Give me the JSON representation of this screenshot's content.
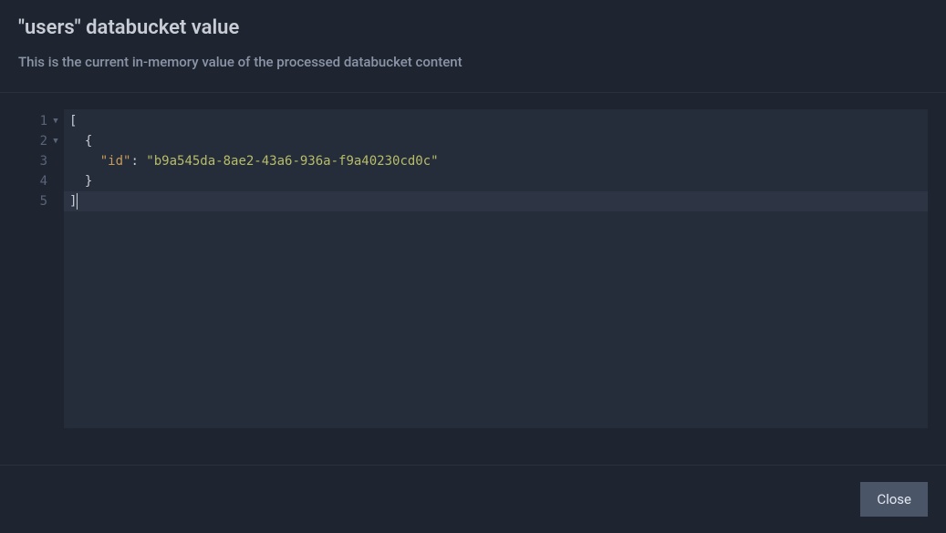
{
  "modal": {
    "title": "\"users\" databucket value",
    "subtitle": "This is the current in-memory value of the processed databucket content"
  },
  "editor": {
    "lines": [
      {
        "num": "1",
        "foldable": true,
        "tokens": [
          {
            "t": "punct",
            "v": "["
          }
        ],
        "active": false
      },
      {
        "num": "2",
        "foldable": true,
        "tokens": [
          {
            "t": "indent",
            "v": "  "
          },
          {
            "t": "punct",
            "v": "{"
          }
        ],
        "active": false
      },
      {
        "num": "3",
        "foldable": false,
        "tokens": [
          {
            "t": "indent",
            "v": "    "
          },
          {
            "t": "key",
            "v": "\"id\""
          },
          {
            "t": "punct",
            "v": ": "
          },
          {
            "t": "string",
            "v": "\"b9a545da-8ae2-43a6-936a-f9a40230cd0c\""
          }
        ],
        "active": false
      },
      {
        "num": "4",
        "foldable": false,
        "tokens": [
          {
            "t": "indent",
            "v": "  "
          },
          {
            "t": "punct",
            "v": "}"
          }
        ],
        "active": false
      },
      {
        "num": "5",
        "foldable": false,
        "tokens": [
          {
            "t": "punct",
            "v": "]"
          }
        ],
        "active": true,
        "cursor": true
      }
    ]
  },
  "footer": {
    "close_label": "Close"
  }
}
